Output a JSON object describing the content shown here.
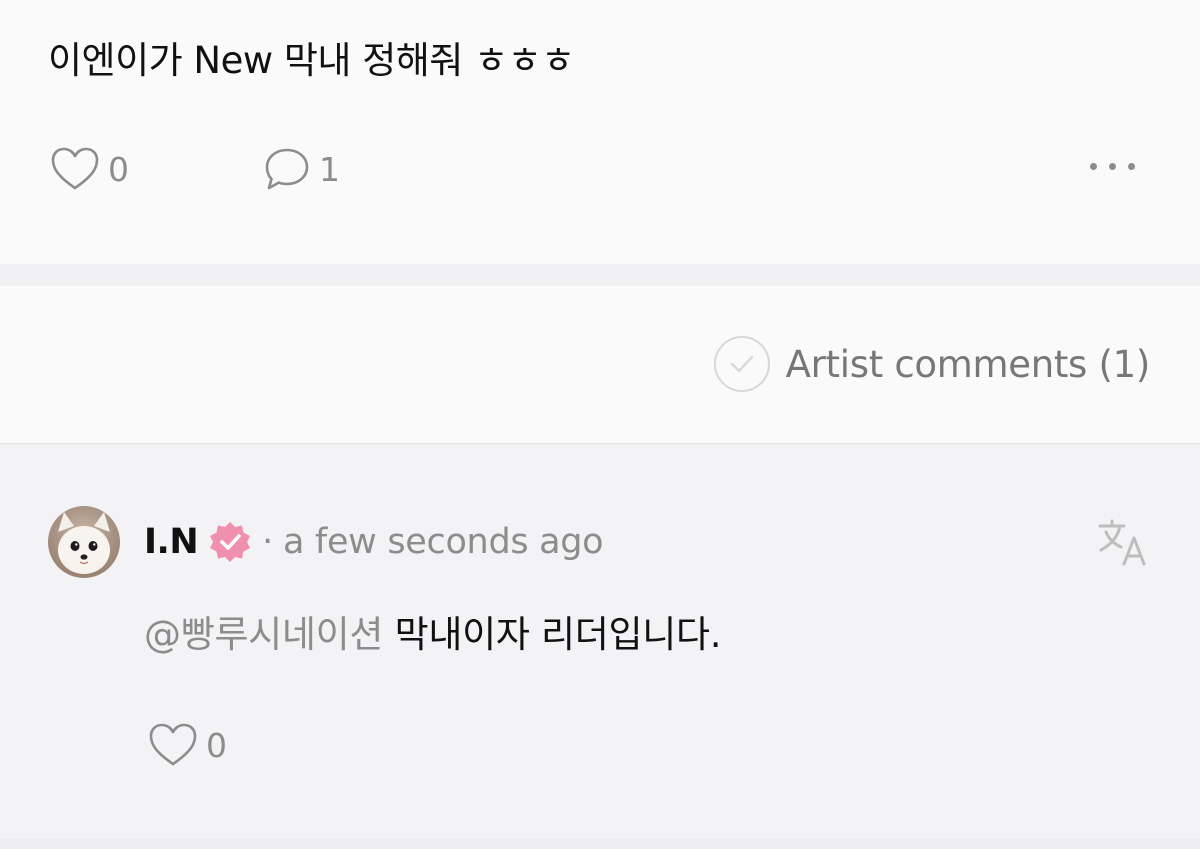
{
  "post": {
    "text": "이엔이가 New 막내 정해줘 ㅎㅎㅎ",
    "like_count": "0",
    "comment_count": "1",
    "icons": [
      "heart-icon",
      "comment-bubble-icon",
      "more-options-icon"
    ]
  },
  "artist_comments": {
    "label": "Artist comments (1)",
    "icon": "check-circle-icon"
  },
  "comment": {
    "author": "I.N",
    "separator": "·",
    "time": "a few seconds ago",
    "mention": "@빵루시네이션",
    "text": "막내이자 리더입니다.",
    "like_count": "0",
    "icons": [
      "avatar",
      "verified-badge-icon",
      "translate-icon",
      "heart-icon"
    ]
  },
  "colors": {
    "background": "#fafafa",
    "comment_background": "#f3f3f6",
    "muted_text": "#8c8c8c",
    "badge_pink": "#f08fae"
  }
}
